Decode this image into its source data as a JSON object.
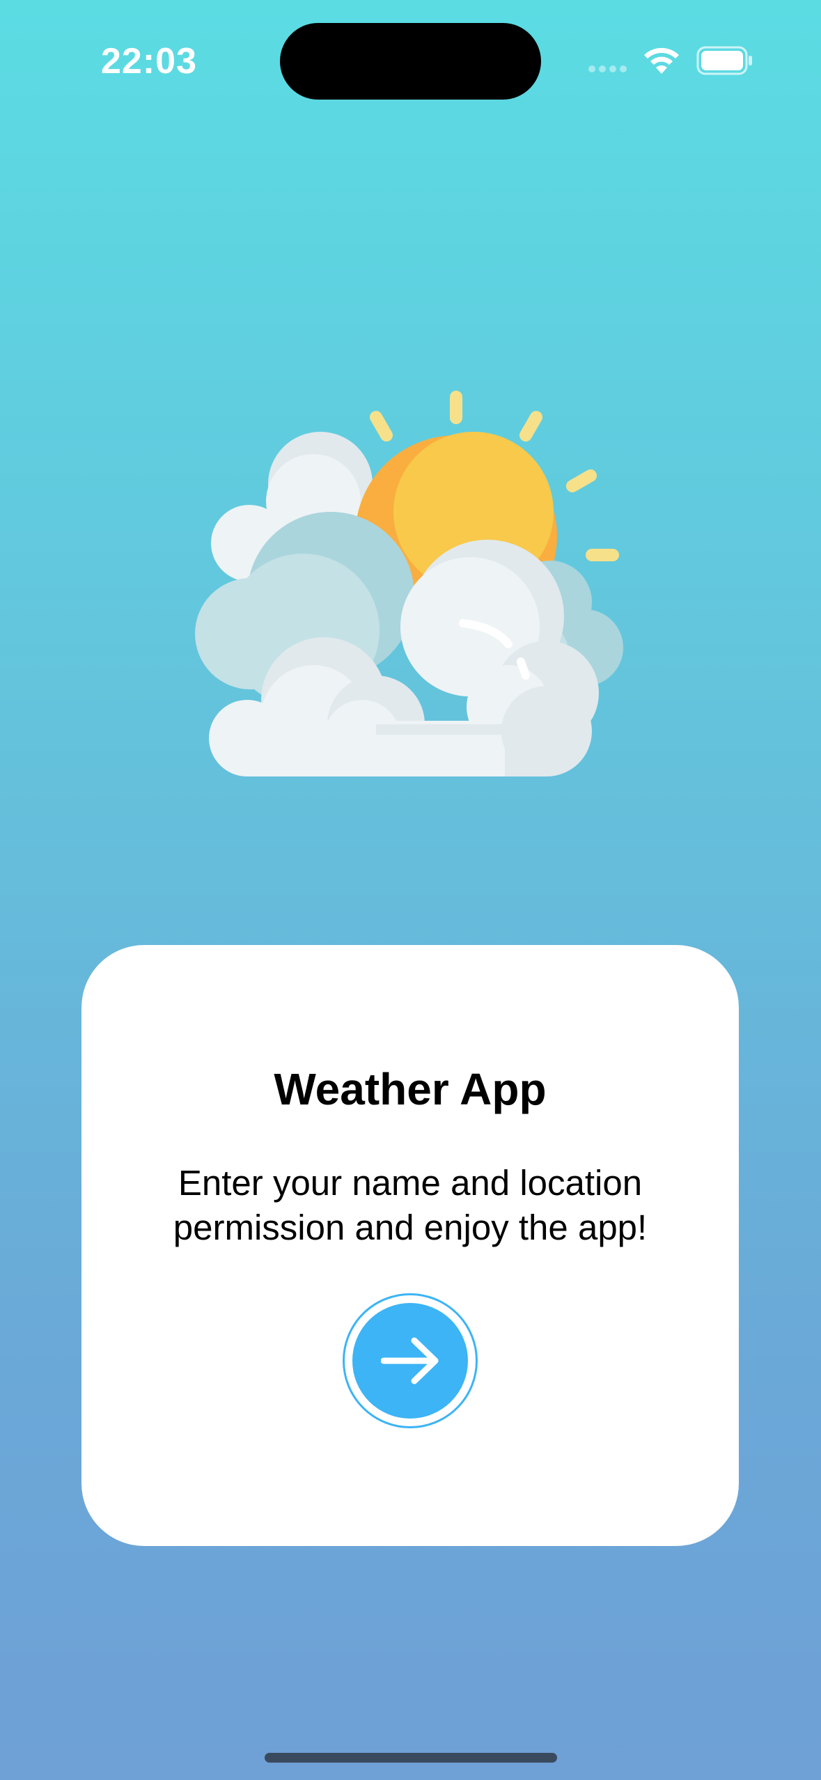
{
  "status_bar": {
    "time": "22:03",
    "icons": [
      "signal-dots-icon",
      "wifi-icon",
      "battery-icon"
    ]
  },
  "illustration": {
    "icon": "partly-cloudy-sun-icon"
  },
  "card": {
    "title": "Weather App",
    "subtitle": "Enter your name and location permission and enjoy the app!",
    "next_button_icon": "arrow-right-icon"
  },
  "colors": {
    "accent": "#3cb4f5",
    "background_top": "#5bdce3",
    "background_bottom": "#6fa0d6",
    "sun": "#f8c94a",
    "sun_shadow": "#f9ae3f"
  }
}
